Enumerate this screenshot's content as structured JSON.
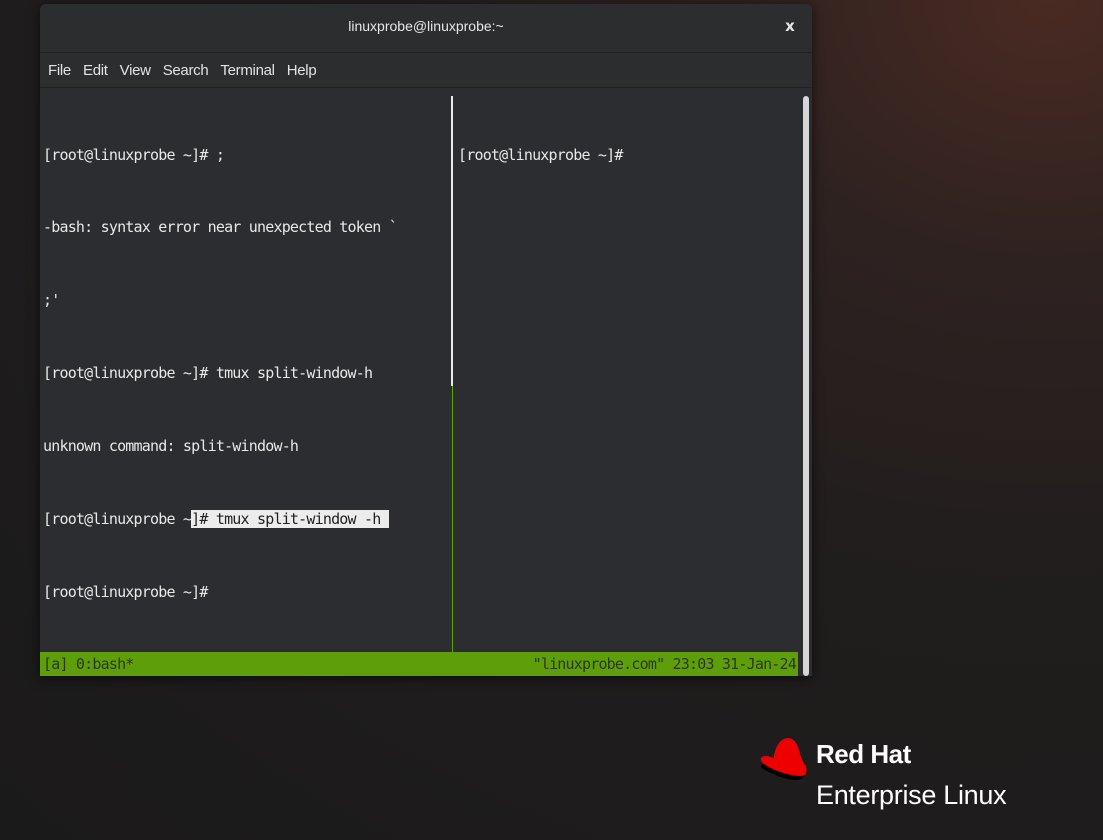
{
  "window": {
    "title": "linuxprobe@linuxprobe:~",
    "close_label": "x"
  },
  "menu": {
    "items": [
      {
        "label": "File"
      },
      {
        "label": "Edit"
      },
      {
        "label": "View"
      },
      {
        "label": "Search"
      },
      {
        "label": "Terminal"
      },
      {
        "label": "Help"
      }
    ]
  },
  "left_pane": {
    "lines": [
      "[root@linuxprobe ~]# ;",
      "-bash: syntax error near unexpected token `",
      ";'",
      "[root@linuxprobe ~]# tmux split-window-h",
      "unknown command: split-window-h",
      "[root@linuxprobe ~",
      "[root@linuxprobe ~]#"
    ],
    "highlighted_command": "]# tmux split-window -h "
  },
  "right_pane": {
    "lines": [
      "[root@linuxprobe ~]#"
    ]
  },
  "status_bar": {
    "left": "[a] 0:bash*",
    "right": "\"linuxprobe.com\" 23:03 31-Jan-24"
  },
  "brand": {
    "line1": "Red Hat",
    "line2": "Enterprise Linux",
    "accent_color": "#ee0000"
  }
}
